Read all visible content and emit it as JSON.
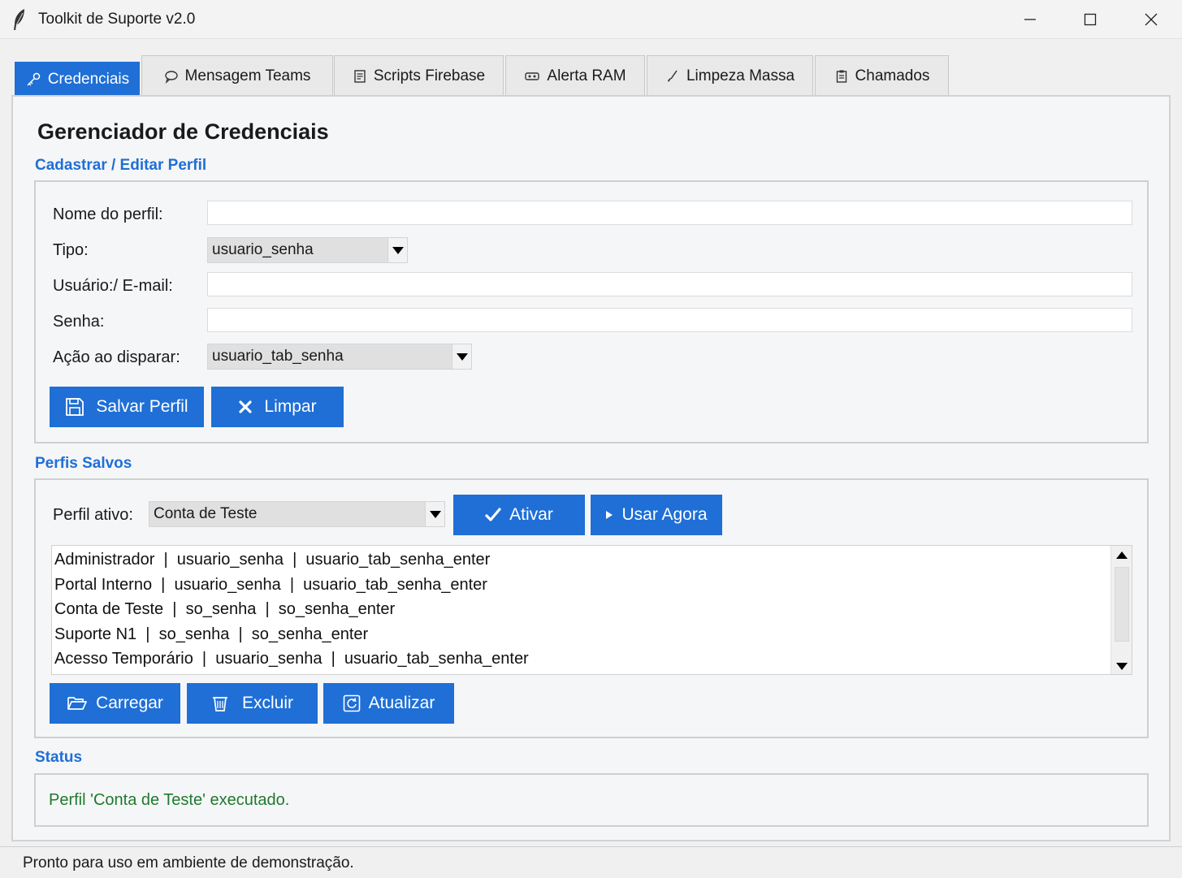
{
  "window": {
    "title": "Toolkit de Suporte v2.0",
    "icon": "feather-icon"
  },
  "tabs": [
    {
      "label": "Credenciais",
      "icon": "key-icon",
      "active": true
    },
    {
      "label": "Mensagem Teams",
      "icon": "chat-bubble-icon",
      "active": false
    },
    {
      "label": "Scripts Firebase",
      "icon": "script-icon",
      "active": false
    },
    {
      "label": "Alerta RAM",
      "icon": "memory-icon",
      "active": false
    },
    {
      "label": "Limpeza Massa",
      "icon": "broom-icon",
      "active": false
    },
    {
      "label": "Chamados",
      "icon": "clipboard-icon",
      "active": false
    }
  ],
  "page": {
    "title": "Gerenciador de Credenciais"
  },
  "form": {
    "section_title": "Cadastrar / Editar Perfil",
    "nome_label": "Nome do perfil:",
    "nome_value": "",
    "tipo_label": "Tipo:",
    "tipo_value": "usuario_senha",
    "usuario_label": "Usuário:/ E-mail:",
    "usuario_value": "",
    "senha_label": "Senha:",
    "senha_value": "",
    "acao_label": "Ação ao disparar:",
    "acao_value": "usuario_tab_senha",
    "save_button": "Salvar Perfil",
    "clear_button": "Limpar"
  },
  "saved": {
    "section_title": "Perfis Salvos",
    "active_label": "Perfil ativo:",
    "active_value": "Conta de Teste",
    "activate_button": "Ativar",
    "use_now_button": "Usar Agora",
    "profiles": [
      "Administrador  |  usuario_senha  |  usuario_tab_senha_enter",
      "Portal Interno  |  usuario_senha  |  usuario_tab_senha_enter",
      "Conta de Teste  |  so_senha  |  so_senha_enter",
      "Suporte N1  |  so_senha  |  so_senha_enter",
      "Acesso Temporário  |  usuario_senha  |  usuario_tab_senha_enter"
    ],
    "load_button": "Carregar",
    "delete_button": "Excluir",
    "refresh_button": "Atualizar"
  },
  "status": {
    "section_title": "Status",
    "message": "Perfil 'Conta de Teste' executado.",
    "message_color": "#1f7a2d"
  },
  "statusbar": {
    "text": "Pronto para uso em ambiente de demonstração."
  },
  "colors": {
    "accent": "#1f6fd6",
    "background": "#f5f6f8"
  }
}
